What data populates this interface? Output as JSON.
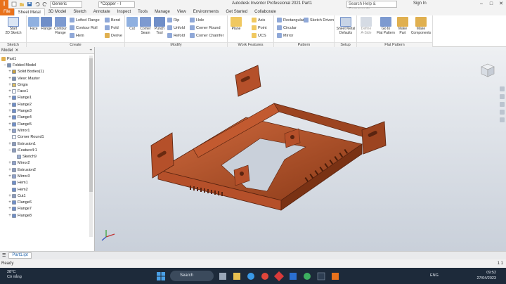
{
  "app": {
    "logo_letter": "I",
    "title": "Autodesk Inventor Professional 2021    Part1",
    "material_combo": "Generic",
    "appearance_combo": "*Copper - I",
    "search_placeholder": "Search Help & Commands...",
    "signin": "Sign In",
    "accent": "#e8721c"
  },
  "tabs": [
    "File",
    "Sheet Metal",
    "3D Model",
    "Sketch",
    "Annotate",
    "Inspect",
    "Tools",
    "Manage",
    "View",
    "Environments",
    "Get Started",
    "Collaborate"
  ],
  "ribbon": {
    "sketch": {
      "title": "Sketch",
      "start_line1": "Start",
      "start_line2": "2D Sketch"
    },
    "create": {
      "title": "Create",
      "face": "Face",
      "flange": "Flange",
      "contour_flange_1": "Contour",
      "contour_flange_2": "Flange",
      "lofted_flange": "Lofted Flange",
      "contour_roll": "Contour Roll",
      "hem": "Hem",
      "bend": "Bend",
      "fold": "Fold",
      "derive": "Derive"
    },
    "modify": {
      "title": "Modify",
      "cut": "Cut",
      "corner_seam_1": "Corner",
      "corner_seam_2": "Seam",
      "punch_tool_1": "Punch",
      "punch_tool_2": "Tool",
      "rip": "Rip",
      "unfold": "Unfold",
      "refold": "Refold",
      "hole": "Hole",
      "corner_round": "Corner Round",
      "corner_chamfer": "Corner Chamfer"
    },
    "work_features": {
      "title": "Work Features",
      "plane": "Plane",
      "axis": "Axis",
      "point": "Point",
      "ucs": "UCS"
    },
    "pattern": {
      "title": "Pattern",
      "rectangular": "Rectangular",
      "circular": "Circular",
      "mirror": "Mirror",
      "sketch_driven": "Sketch Driven"
    },
    "setup": {
      "title": "Setup",
      "defaults_1": "Sheet Metal",
      "defaults_2": "Defaults"
    },
    "flat_pattern": {
      "title": "Flat Pattern",
      "define_aside_1": "Define",
      "define_aside_2": "A-Side",
      "goto_flat_1": "Go to",
      "goto_flat_2": "Flat Pattern",
      "make_part_1": "Make",
      "make_part_2": "Part",
      "make_components_1": "Make",
      "make_components_2": "Components"
    }
  },
  "browser": {
    "header": "Model",
    "root": "Part1",
    "nodes": [
      {
        "label": "Folded Model",
        "exp": "−",
        "color": "#7a8fb0",
        "indent": 0
      },
      {
        "label": "Solid Bodies(1)",
        "exp": "+",
        "color": "#c8a040",
        "indent": 1
      },
      {
        "label": "View: Master",
        "exp": "+",
        "color": "#7a8fb0",
        "indent": 1
      },
      {
        "label": "Origin",
        "exp": "+",
        "color": "#e0c060",
        "indent": 1
      },
      {
        "label": "Face1",
        "exp": "+",
        "color": "#ffffff",
        "indent": 1
      },
      {
        "label": "Flange1",
        "exp": "+",
        "color": "#6f8ec8",
        "indent": 1
      },
      {
        "label": "Flange2",
        "exp": "+",
        "color": "#6f8ec8",
        "indent": 1
      },
      {
        "label": "Flange3",
        "exp": "+",
        "color": "#6f8ec8",
        "indent": 1
      },
      {
        "label": "Flange4",
        "exp": "+",
        "color": "#6f8ec8",
        "indent": 1
      },
      {
        "label": "Flange5",
        "exp": "+",
        "color": "#6f8ec8",
        "indent": 1
      },
      {
        "label": "Mirror1",
        "exp": "+",
        "color": "#8fa0c8",
        "indent": 1
      },
      {
        "label": "Corner Round1",
        "exp": "",
        "color": "#ffffff",
        "indent": 1
      },
      {
        "label": "Extrusion1",
        "exp": "+",
        "color": "#8c9ab8",
        "indent": 1
      },
      {
        "label": "iFeature4:1",
        "exp": "−",
        "color": "#8c9ab8",
        "indent": 1
      },
      {
        "label": "Sketch9",
        "exp": "",
        "color": "#9fb0d0",
        "indent": 2
      },
      {
        "label": "Mirror2",
        "exp": "+",
        "color": "#8fa0c8",
        "indent": 1
      },
      {
        "label": "Extrusion2",
        "exp": "+",
        "color": "#8c9ab8",
        "indent": 1
      },
      {
        "label": "Mirror3",
        "exp": "+",
        "color": "#8fa0c8",
        "indent": 1
      },
      {
        "label": "Hem1",
        "exp": "",
        "color": "#6f8ec8",
        "indent": 1
      },
      {
        "label": "Hem2",
        "exp": "",
        "color": "#6f8ec8",
        "indent": 1
      },
      {
        "label": "Cut1",
        "exp": "+",
        "color": "#8c9ab8",
        "indent": 1
      },
      {
        "label": "Flange6",
        "exp": "+",
        "color": "#6f8ec8",
        "indent": 1
      },
      {
        "label": "Flange7",
        "exp": "+",
        "color": "#6f8ec8",
        "indent": 1
      },
      {
        "label": "Flange8",
        "exp": "+",
        "color": "#6f8ec8",
        "indent": 1
      }
    ]
  },
  "doc_tab": "Part1.ipt",
  "status": {
    "left": "Ready",
    "right": "1 1"
  },
  "taskbar": {
    "temp": "28°C",
    "weather": "Có nắng",
    "search": "Search",
    "lang": "ENG",
    "time": "09:52",
    "date": "27/04/2023"
  },
  "colors": {
    "copper": "#b5502a",
    "copper_dark": "#7a3214",
    "copper_light": "#d06a3e"
  }
}
